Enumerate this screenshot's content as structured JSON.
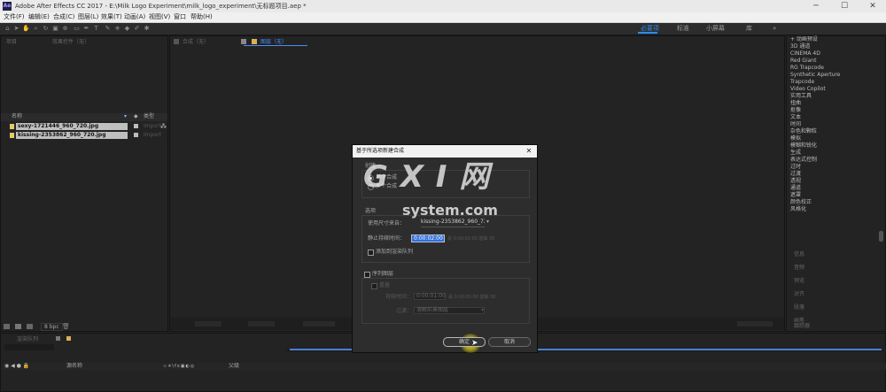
{
  "window": {
    "app_icon": "Ae",
    "title": "Adobe After Effects CC 2017 - E:\\Milk Logo Experiment\\milk_logo_experiment\\无标题项目.aep *",
    "controls": [
      "─",
      "☐",
      "✕"
    ]
  },
  "menu": [
    "文件(F)",
    "编辑(E)",
    "合成(C)",
    "图层(L)",
    "效果(T)",
    "动画(A)",
    "视图(V)",
    "窗口",
    "帮助(H)"
  ],
  "workspaces": {
    "default": "必要项",
    "standard": "标准",
    "small_screen": "小屏幕",
    "library": "库",
    "menu": "»"
  },
  "project_panel": {
    "tab_project": "项目",
    "tab_effects": "效果控件（无）",
    "col_name": "名称",
    "col_type": "类型",
    "items": [
      {
        "name": "sexy-1721446_960_720.jpg",
        "type": "Import"
      },
      {
        "name": "kissing-2353862_960_720.jpg",
        "type": "Import"
      }
    ],
    "bpc": "8 bpc"
  },
  "comp_panel": {
    "tab_comp": "合成（无）",
    "tab_layer": "图层（无）"
  },
  "effects_list": [
    "+ 动画预设",
    "3D 通道",
    "CINEMA 4D",
    "Red Giant",
    "RG Trapcode",
    "Synthetic Aperture",
    "Trapcode",
    "Video Copilot",
    "实用工具",
    "扭曲",
    "抠像",
    "文本",
    "时间",
    "杂色和颗粒",
    "模拟",
    "模糊和锐化",
    "生成",
    "表达式控制",
    "过时",
    "过渡",
    "透视",
    "通道",
    "遮罩",
    "颜色校正",
    "风格化"
  ],
  "right_panels": [
    "信息",
    "音频",
    "预览",
    "对齐",
    "段落",
    "画笔",
    "跟踪器"
  ],
  "timeline": {
    "tab": "渲染队列",
    "col_source": "源名称",
    "col_parent": "父级"
  },
  "dialog": {
    "title": "基于所选项新建合成",
    "create_label": "创建",
    "single_comp": "单个合成",
    "multi_comp": "多个合成",
    "options_label": "选项",
    "use_dims_label": "使用尺寸来自：",
    "use_dims_value": "kissing-2353862_960_720.jpg",
    "still_duration_label": "静止持续时间：",
    "still_duration_value": "0:00:02:00",
    "still_duration_suffix": "是 0:00:02:00  基础 30",
    "add_render_queue": "添加到渲染队列",
    "sequence_layers": "序列图层",
    "overlap": "重叠",
    "duration_label": "持续时间：",
    "duration_value": "0:00:01:00",
    "duration_suffix": "是 0:00:01:00  基础 30",
    "transition_label": "过渡：",
    "transition_value": "溶解前景图层",
    "ok": "确定",
    "cancel": "取消"
  },
  "watermark": {
    "big": "G X I 网",
    "small": "system.com"
  },
  "colors": {
    "titlebar": "#e9e9e9",
    "panel": "#232323",
    "accent": "#2d8ceb",
    "highlight": "#2f6fe0",
    "cursor_glow": "#f4e40c"
  }
}
